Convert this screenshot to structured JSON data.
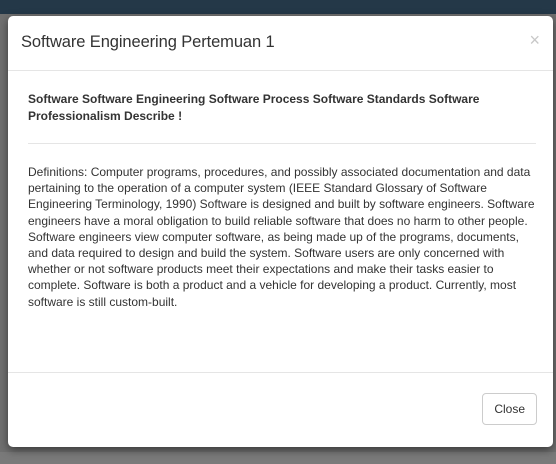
{
  "modal": {
    "title": "Software Engineering Pertemuan 1",
    "close_symbol": "×",
    "question": "Software Software Engineering Software Process Software Standards Software Professionalism Describe !",
    "answer": "Definitions: Computer programs, procedures, and possibly associated documentation and data pertaining to the operation of a computer system (IEEE Standard Glossary of Software Engineering Terminology, 1990) Software is designed and built by software engineers. Software engineers have a moral obligation to build reliable software that does no harm to other people. Software engineers view computer software, as being made up of the programs, documents, and data required to design and build the system. Software users are only concerned with whether or not software products meet their expectations and make their tasks easier to complete. Software is both a product and a vehicle for developing a product. Currently, most software is still custom-built.",
    "close_button_label": "Close"
  },
  "colors": {
    "backdrop": "#707070",
    "navbar": "#243848",
    "modal_bg": "#ffffff",
    "text": "#333333",
    "border": "#e5e5e5"
  }
}
